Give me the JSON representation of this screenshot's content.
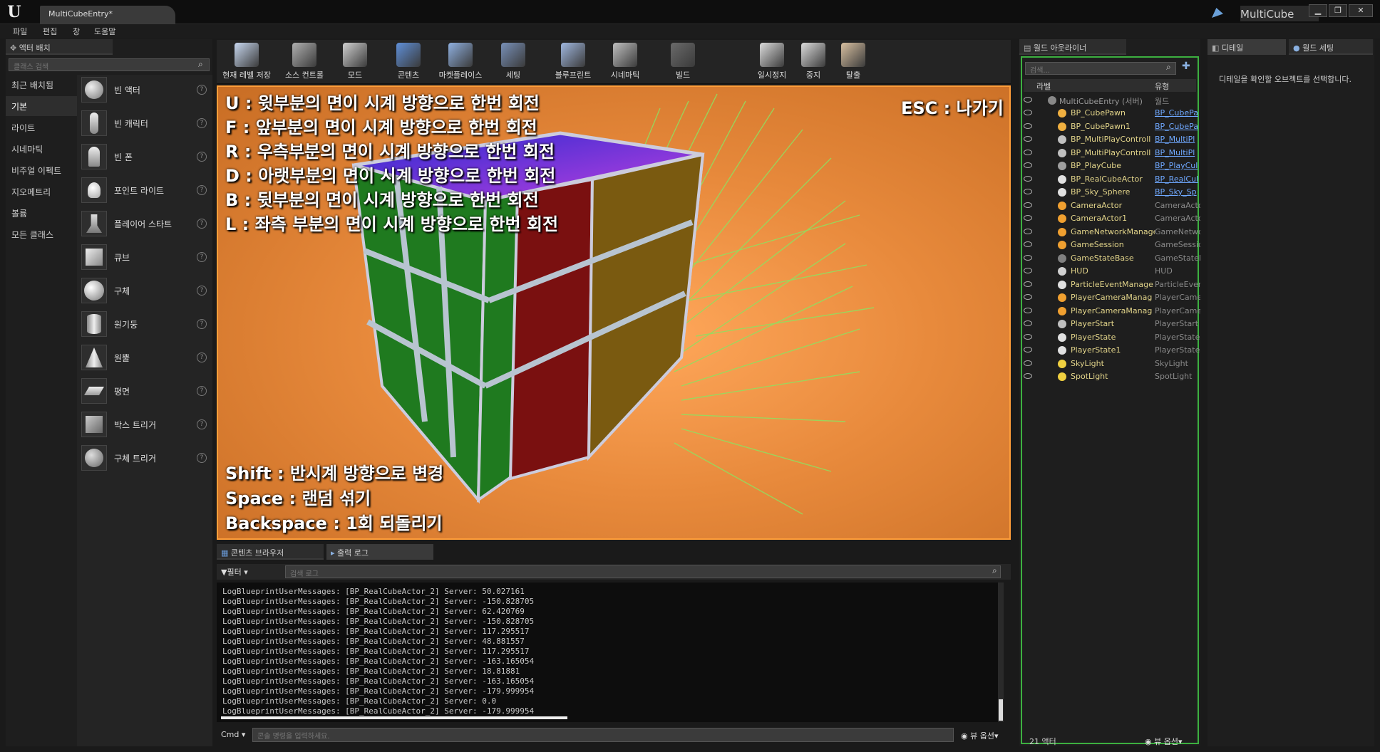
{
  "app": {
    "doc_tab": "MultiCubeEntry*",
    "project": "MultiCube"
  },
  "menu": [
    "파일",
    "편집",
    "창",
    "도움말"
  ],
  "actor_panel": {
    "tab": "액터 배치",
    "search_placeholder": "클래스 검색",
    "categories": [
      "최근 배치됨",
      "기본",
      "라이트",
      "시네마틱",
      "비주얼 이펙트",
      "지오메트리",
      "볼륨",
      "모든 클래스"
    ],
    "active_category": "기본",
    "actors": [
      "빈 액터",
      "빈 캐릭터",
      "빈 폰",
      "포인트 라이트",
      "플레이어 스타트",
      "큐브",
      "구체",
      "원기둥",
      "원뿔",
      "평면",
      "박스 트리거",
      "구체 트리거"
    ]
  },
  "toolbar": {
    "buttons": [
      {
        "label": "현재 레벨 저장",
        "icon": "save-icon",
        "color": "#c8d8f0"
      },
      {
        "label": "소스 컨트롤",
        "icon": "source-control-icon",
        "color": "#b0b0b0"
      },
      {
        "label": "모드",
        "icon": "modes-icon",
        "color": "#d0d0d0"
      },
      {
        "label": "콘텐츠",
        "icon": "content-icon",
        "color": "#5f8fd8"
      },
      {
        "label": "마켓플레이스",
        "icon": "marketplace-icon",
        "color": "#8fb0e0"
      },
      {
        "label": "세팅",
        "icon": "settings-icon",
        "color": "#7890b8"
      },
      {
        "label": "블루프린트",
        "icon": "blueprint-icon",
        "color": "#a0b8e0"
      },
      {
        "label": "시네마틱",
        "icon": "cinematics-icon",
        "color": "#c0c0c0"
      },
      {
        "label": "빌드",
        "icon": "build-icon",
        "color": "#6a6a6a"
      },
      {
        "label": "일시정지",
        "icon": "pause-icon",
        "color": "#dcdcdc"
      },
      {
        "label": "중지",
        "icon": "stop-icon",
        "color": "#dcdcdc"
      },
      {
        "label": "탈출",
        "icon": "eject-icon",
        "color": "#d8c0a0"
      }
    ]
  },
  "viewport": {
    "instructions": [
      "U : 윗부분의 면이 시계 방향으로 한번 회전",
      "F : 앞부분의 면이 시계 방향으로 한번 회전",
      "R : 우측부분의 면이 시계 방향으로 한번 회전",
      "D : 아랫부분의 면이 시계 방향으로 한번 회전",
      "B : 뒷부분의 면이 시계 방향으로 한번 회전",
      "L : 좌측 부분의 면이 시계 방향으로 한번 회전"
    ],
    "esc_hint": "ESC : 나가기",
    "bottom_hints": [
      "Shift : 반시계 방향으로 변경",
      "Space : 랜덤 섞기",
      "Backspace : 1회 되돌리기"
    ]
  },
  "bottom_panel": {
    "tabs": [
      "콘텐츠 브라우저",
      "출력 로그"
    ],
    "filter_label": "필터",
    "search_placeholder": "검색 로그",
    "log_lines": [
      "LogBlueprintUserMessages: [BP_RealCubeActor_2] Server: 50.027161",
      "LogBlueprintUserMessages: [BP_RealCubeActor_2] Server: -150.828705",
      "LogBlueprintUserMessages: [BP_RealCubeActor_2] Server: 62.420769",
      "LogBlueprintUserMessages: [BP_RealCubeActor_2] Server: -150.828705",
      "LogBlueprintUserMessages: [BP_RealCubeActor_2] Server: 117.295517",
      "LogBlueprintUserMessages: [BP_RealCubeActor_2] Server: 48.881557",
      "LogBlueprintUserMessages: [BP_RealCubeActor_2] Server: 117.295517",
      "LogBlueprintUserMessages: [BP_RealCubeActor_2] Server: -163.165054",
      "LogBlueprintUserMessages: [BP_RealCubeActor_2] Server: 18.81881",
      "LogBlueprintUserMessages: [BP_RealCubeActor_2] Server: -163.165054",
      "LogBlueprintUserMessages: [BP_RealCubeActor_2] Server: -179.999954",
      "LogBlueprintUserMessages: [BP_RealCubeActor_2] Server: 0.0",
      "LogBlueprintUserMessages: [BP_RealCubeActor_2] Server: -179.999954"
    ],
    "cmd_label": "Cmd",
    "cmd_placeholder": "콘솔 명령을 입력하세요.",
    "view_options": "뷰 옵션"
  },
  "outliner": {
    "tab": "월드 아웃라이너",
    "search_placeholder": "검색...",
    "col_label": "라벨",
    "col_type": "유형",
    "root": {
      "name": "MultiCubeEntry (서버)",
      "type": "월드"
    },
    "rows": [
      {
        "name": "BP_CubePawn",
        "type": "BP_CubePa",
        "link": true,
        "color": "#f0b040"
      },
      {
        "name": "BP_CubePawn1",
        "type": "BP_CubePa",
        "link": true,
        "color": "#f0b040"
      },
      {
        "name": "BP_MultiPlayControll",
        "type": "BP_MultiPl",
        "link": true,
        "color": "#c0c0c0"
      },
      {
        "name": "BP_MultiPlayControll",
        "type": "BP_MultiPl",
        "link": true,
        "color": "#c0c0c0"
      },
      {
        "name": "BP_PlayCube",
        "type": "BP_PlayCul",
        "link": true,
        "color": "#a0a0a0"
      },
      {
        "name": "BP_RealCubeActor",
        "type": "BP_RealCul",
        "link": true,
        "color": "#e0e0e0"
      },
      {
        "name": "BP_Sky_Sphere",
        "type": "BP_Sky_Sp",
        "link": true,
        "color": "#e0e0e0"
      },
      {
        "name": "CameraActor",
        "type": "CameraActo",
        "link": false,
        "color": "#f0a030"
      },
      {
        "name": "CameraActor1",
        "type": "CameraActo",
        "link": false,
        "color": "#f0a030"
      },
      {
        "name": "GameNetworkManage",
        "type": "GameNetwo",
        "link": false,
        "color": "#f0a030"
      },
      {
        "name": "GameSession",
        "type": "GameSessio",
        "link": false,
        "color": "#f0a030"
      },
      {
        "name": "GameStateBase",
        "type": "GameStateB",
        "link": false,
        "color": "#808080"
      },
      {
        "name": "HUD",
        "type": "HUD",
        "link": false,
        "color": "#d0d0d0"
      },
      {
        "name": "ParticleEventManage",
        "type": "ParticleEven",
        "link": false,
        "color": "#e0e0e0"
      },
      {
        "name": "PlayerCameraManag",
        "type": "PlayerCame",
        "link": false,
        "color": "#f0a030"
      },
      {
        "name": "PlayerCameraManag",
        "type": "PlayerCame",
        "link": false,
        "color": "#f0a030"
      },
      {
        "name": "PlayerStart",
        "type": "PlayerStart",
        "link": false,
        "color": "#c0c0c0"
      },
      {
        "name": "PlayerState",
        "type": "PlayerState",
        "link": false,
        "color": "#e0e0e0"
      },
      {
        "name": "PlayerState1",
        "type": "PlayerState",
        "link": false,
        "color": "#e0e0e0"
      },
      {
        "name": "SkyLight",
        "type": "SkyLight",
        "link": false,
        "color": "#f0d040"
      },
      {
        "name": "SpotLight",
        "type": "SpotLight",
        "link": false,
        "color": "#f0d040"
      }
    ],
    "count": "21 액터",
    "view_options": "뷰 옵션"
  },
  "details": {
    "tab": "디테일",
    "tab2": "월드 세팅",
    "message": "디테일을 확인할 오브젝트를 선택합니다."
  }
}
